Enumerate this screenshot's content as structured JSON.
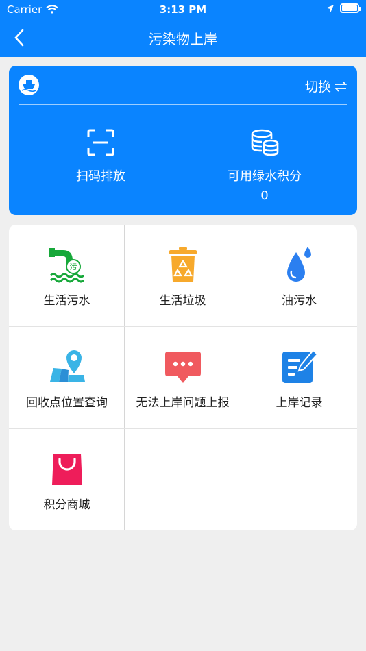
{
  "status": {
    "carrier": "Carrier",
    "time": "3:13 PM"
  },
  "nav": {
    "title": "污染物上岸"
  },
  "card": {
    "switch_label": "切换",
    "scan_label": "扫码排放",
    "points_label": "可用绿水积分",
    "points_value": "0"
  },
  "grid": [
    {
      "label": "生活污水",
      "icon": "sewage-icon"
    },
    {
      "label": "生活垃圾",
      "icon": "recycle-bin-icon"
    },
    {
      "label": "油污水",
      "icon": "oil-drop-icon"
    },
    {
      "label": "回收点位置查询",
      "icon": "map-pin-icon"
    },
    {
      "label": "无法上岸问题上报",
      "icon": "chat-bubble-icon"
    },
    {
      "label": "上岸记录",
      "icon": "edit-note-icon"
    },
    {
      "label": "积分商城",
      "icon": "shopping-bag-icon"
    }
  ],
  "colors": {
    "primary": "#0a84ff",
    "green": "#17a83a",
    "orange": "#f7a92c",
    "red": "#f05a5f",
    "pink": "#ee1d5a"
  }
}
